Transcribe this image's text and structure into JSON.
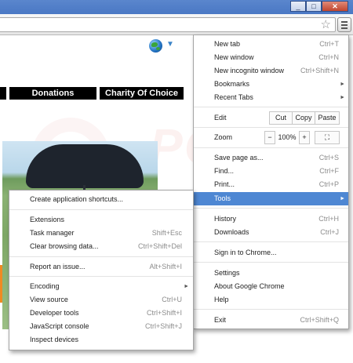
{
  "window": {
    "minimize_glyph": "_",
    "maximize_glyph": "□",
    "close_glyph": "✕"
  },
  "toolbar": {
    "star_icon": "star-icon",
    "menu_icon": "hamburger-menu-icon"
  },
  "page": {
    "nav": [
      "Donations",
      "Charity Of Choice"
    ],
    "globe_arrow": "▼"
  },
  "main_menu": {
    "new_tab": {
      "label": "New tab",
      "shortcut": "Ctrl+T"
    },
    "new_window": {
      "label": "New window",
      "shortcut": "Ctrl+N"
    },
    "new_incognito": {
      "label": "New incognito window",
      "shortcut": "Ctrl+Shift+N"
    },
    "bookmarks": {
      "label": "Bookmarks"
    },
    "recent_tabs": {
      "label": "Recent Tabs"
    },
    "edit": {
      "label": "Edit",
      "cut": "Cut",
      "copy": "Copy",
      "paste": "Paste"
    },
    "zoom": {
      "label": "Zoom",
      "minus": "−",
      "value": "100%",
      "plus": "+",
      "fullscreen": "⛶"
    },
    "save_page": {
      "label": "Save page as...",
      "shortcut": "Ctrl+S"
    },
    "find": {
      "label": "Find...",
      "shortcut": "Ctrl+F"
    },
    "print": {
      "label": "Print...",
      "shortcut": "Ctrl+P"
    },
    "tools": {
      "label": "Tools"
    },
    "history": {
      "label": "History",
      "shortcut": "Ctrl+H"
    },
    "downloads": {
      "label": "Downloads",
      "shortcut": "Ctrl+J"
    },
    "sign_in": {
      "label": "Sign in to Chrome..."
    },
    "settings": {
      "label": "Settings"
    },
    "about": {
      "label": "About Google Chrome"
    },
    "help": {
      "label": "Help"
    },
    "exit": {
      "label": "Exit",
      "shortcut": "Ctrl+Shift+Q"
    },
    "submenu_arrow": "►"
  },
  "tools_menu": {
    "create_shortcuts": {
      "label": "Create application shortcuts..."
    },
    "extensions": {
      "label": "Extensions"
    },
    "task_manager": {
      "label": "Task manager",
      "shortcut": "Shift+Esc"
    },
    "clear_data": {
      "label": "Clear browsing data...",
      "shortcut": "Ctrl+Shift+Del"
    },
    "report_issue": {
      "label": "Report an issue...",
      "shortcut": "Alt+Shift+I"
    },
    "encoding": {
      "label": "Encoding"
    },
    "view_source": {
      "label": "View source",
      "shortcut": "Ctrl+U"
    },
    "developer_tools": {
      "label": "Developer tools",
      "shortcut": "Ctrl+Shift+I"
    },
    "js_console": {
      "label": "JavaScript console",
      "shortcut": "Ctrl+Shift+J"
    },
    "inspect_devices": {
      "label": "Inspect devices"
    }
  },
  "colors": {
    "highlight": "#4e87d3",
    "titlebar": "#4a78c4",
    "accent_orange": "#f08a22"
  }
}
